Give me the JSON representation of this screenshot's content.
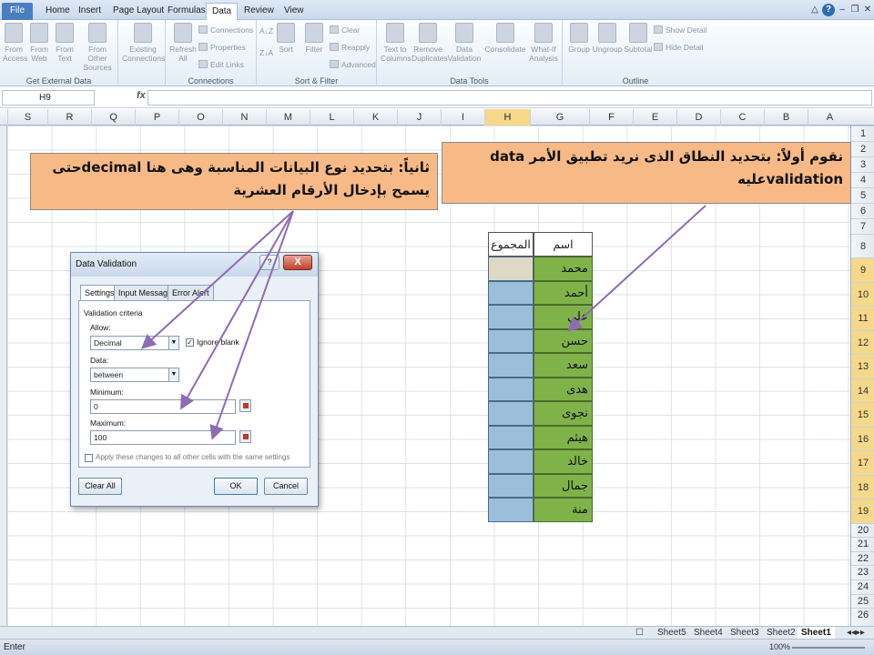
{
  "tabs": [
    "File",
    "Home",
    "Insert",
    "Page Layout",
    "Formulas",
    "Data",
    "Review",
    "View"
  ],
  "ribbon": {
    "get_external": {
      "items": [
        "From Access",
        "From Web",
        "From Text",
        "From Other Sources",
        "Existing Connections"
      ],
      "label": "Get External Data"
    },
    "connections": {
      "refresh": "Refresh All",
      "items": [
        "Connections",
        "Properties",
        "Edit Links"
      ],
      "label": "Connections"
    },
    "sort_filter": {
      "sort": "Sort",
      "filter": "Filter",
      "items": [
        "Clear",
        "Reapply",
        "Advanced"
      ],
      "label": "Sort & Filter"
    },
    "tools": {
      "items": [
        "Text to Columns",
        "Remove Duplicates",
        "Data Validation",
        "Consolidate",
        "What-If Analysis"
      ],
      "label": "Data Tools"
    },
    "outline": {
      "items": [
        "Group",
        "Ungroup",
        "Subtotal"
      ],
      "show": "Show Detail",
      "hide": "Hide Detail",
      "label": "Outline"
    }
  },
  "namebox": "H9",
  "fx": "fx",
  "columns": [
    "S",
    "R",
    "Q",
    "P",
    "O",
    "N",
    "M",
    "L",
    "K",
    "J",
    "I",
    "H",
    "G",
    "F",
    "E",
    "D",
    "C",
    "B",
    "A"
  ],
  "rows": [
    "1",
    "2",
    "3",
    "4",
    "5",
    "6",
    "7",
    "8",
    "9",
    "10",
    "11",
    "12",
    "13",
    "14",
    "15",
    "16",
    "17",
    "18",
    "19",
    "20",
    "21",
    "22",
    "23",
    "24",
    "25",
    "26"
  ],
  "table": {
    "header_name": "اسم الطالب",
    "header_total": "المجموع",
    "names": [
      "محمد",
      "أحمد",
      "علي",
      "حسن",
      "سعد",
      "هدى",
      "نجوى",
      "هيثم",
      "خالد",
      "جمال",
      "منة"
    ]
  },
  "callout1": "نقوم أولاً: بتحديد النطاق الذى نريد تطبيق الأمر data validationعليه",
  "callout2": "ثانياً: بتحديد نوع البيانات المناسبة وهى هنا decimalحتى يسمح بإدخال الأرقام العشرية",
  "dialog": {
    "title": "Data Validation",
    "help": "?",
    "close": "X",
    "tabs": [
      "Settings",
      "Input Message",
      "Error Alert"
    ],
    "criteria": "Validation criteria",
    "allow_label": "Allow:",
    "allow_value": "Decimal",
    "ignore_blank": "Ignore blank",
    "data_label": "Data:",
    "data_value": "between",
    "min_label": "Minimum:",
    "min_value": "0",
    "max_label": "Maximum:",
    "max_value": "100",
    "apply_all": "Apply these changes to all other cells with the same settings",
    "clear_all": "Clear All",
    "ok": "OK",
    "cancel": "Cancel"
  },
  "sheets": [
    "Sheet5",
    "Sheet4",
    "Sheet3",
    "Sheet2",
    "Sheet1"
  ],
  "status": "Enter",
  "zoom": "100%",
  "colors": {
    "green": "#7fb34a",
    "blue": "#9bbfdb",
    "callout": "#f7ba86",
    "arrow": "#8e6bb5"
  }
}
